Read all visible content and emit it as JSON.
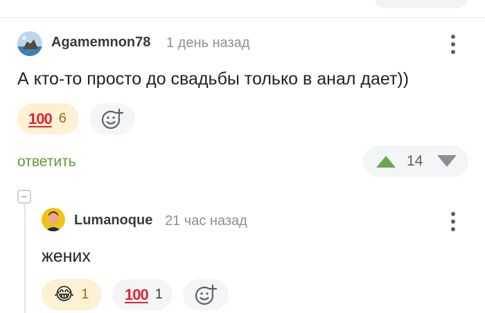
{
  "comment1": {
    "username": "Agamemnon78",
    "time": "1 день назад",
    "text": "А кто-то просто до свадьбы только в анал дает))",
    "reactions": [
      {
        "emoji": "100",
        "count": "6",
        "active": true
      }
    ],
    "add_reaction_icon": "add-reaction-icon",
    "reply_label": "ответить",
    "rating": "14",
    "colors": {
      "upvote": "#6aa84f",
      "downvote": "#8a8f96",
      "reply": "#5f9a3b"
    }
  },
  "comment2": {
    "username": "Lumanoque",
    "time": "21 час назад",
    "text": "жених",
    "reactions": [
      {
        "emoji": "😂",
        "count": "1",
        "active": true
      },
      {
        "emoji": "100",
        "count": "1",
        "active": false
      }
    ],
    "add_reaction_icon": "add-reaction-icon"
  }
}
